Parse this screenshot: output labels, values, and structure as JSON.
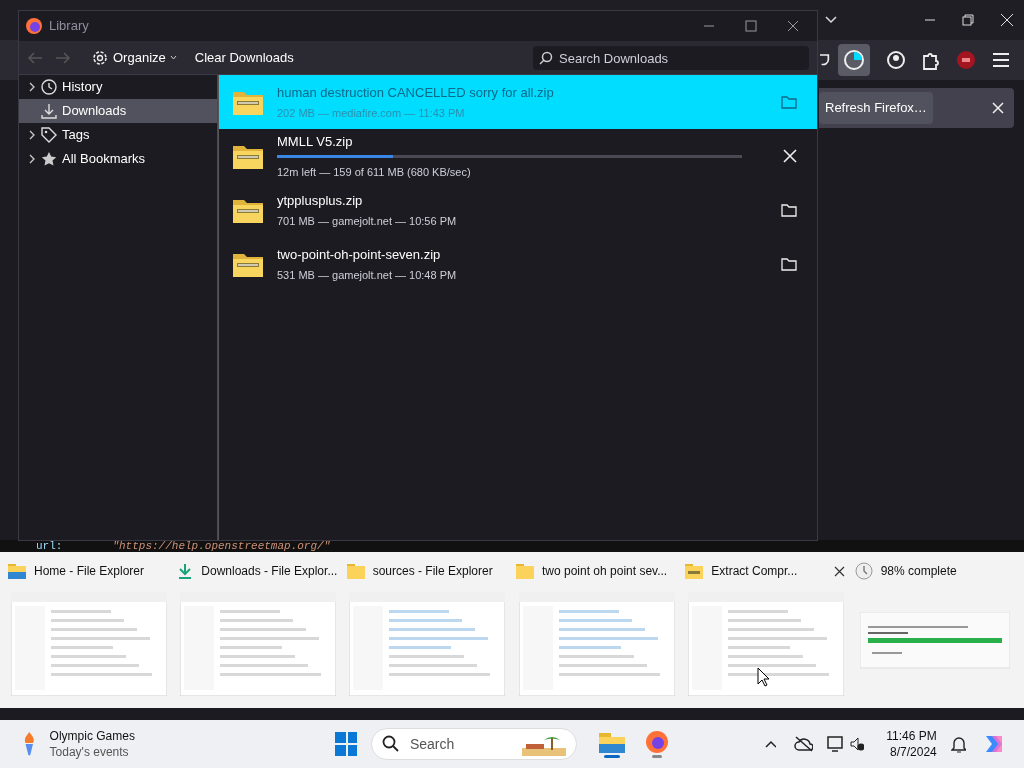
{
  "browser": {
    "notification_button": "Refresh Firefox…",
    "code_key": "url:",
    "code_value": "\"https://help.openstreetmap.org/\""
  },
  "library": {
    "title": "Library",
    "organize": "Organize",
    "clear": "Clear Downloads",
    "search_placeholder": "Search Downloads",
    "sidebar": [
      {
        "label": "History",
        "kind": "clock",
        "expandable": true,
        "selected": false
      },
      {
        "label": "Downloads",
        "kind": "download",
        "expandable": false,
        "selected": true
      },
      {
        "label": "Tags",
        "kind": "tag",
        "expandable": true,
        "selected": false
      },
      {
        "label": "All Bookmarks",
        "kind": "star",
        "expandable": true,
        "selected": false
      }
    ],
    "downloads": [
      {
        "kind": "done",
        "name": "human destruction CANCELLED sorry for all.zip",
        "status": "202 MB — mediafire.com — 11:43 PM",
        "selected": true
      },
      {
        "kind": "in_progress",
        "name": "MMLL V5.zip",
        "status": "12m left — 159 of 611 MB (680 KB/sec)",
        "level": 0.25,
        "selected": false
      },
      {
        "kind": "done",
        "name": "ytpplusplus.zip",
        "status": "701 MB — gamejolt.net — 10:56 PM",
        "selected": false
      },
      {
        "kind": "done",
        "name": "two-point-oh-point-seven.zip",
        "status": "531 MB — gamejolt.net — 10:48 PM",
        "selected": false
      }
    ]
  },
  "task_switcher": [
    {
      "title": "Home - File Explorer",
      "kind": "home",
      "close": false
    },
    {
      "title": "Downloads - File Explor...",
      "kind": "download",
      "close": false
    },
    {
      "title": "sources - File Explorer",
      "kind": "folder",
      "close": false
    },
    {
      "title": "two point oh point sev...",
      "kind": "folder",
      "close": false
    },
    {
      "title": "Extract Compr...",
      "kind": "zip",
      "close": true
    },
    {
      "title": "98% complete",
      "kind": "progress",
      "close": false
    }
  ],
  "taskbar": {
    "widget_title": "Olympic Games",
    "widget_subtitle": "Today's events",
    "search": "Search",
    "time": "11:46 PM",
    "date": "8/7/2024"
  }
}
